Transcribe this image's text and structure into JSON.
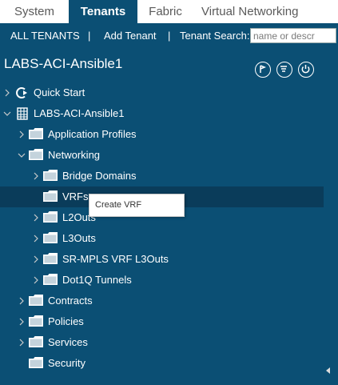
{
  "tabs": [
    {
      "label": "System"
    },
    {
      "label": "Tenants"
    },
    {
      "label": "Fabric"
    },
    {
      "label": "Virtual Networking"
    }
  ],
  "subnav": {
    "all_tenants": "ALL TENANTS",
    "separator": "|",
    "add_tenant": "Add Tenant",
    "search_label": "Tenant Search:",
    "search_placeholder": "name or descr"
  },
  "title": "LABS-ACI-Ansible1",
  "tree": [
    {
      "label": "Quick Start"
    },
    {
      "label": "LABS-ACI-Ansible1"
    },
    {
      "label": "Application Profiles"
    },
    {
      "label": "Networking"
    },
    {
      "label": "Bridge Domains"
    },
    {
      "label": "VRFs"
    },
    {
      "label": "L2Outs"
    },
    {
      "label": "L3Outs"
    },
    {
      "label": "SR-MPLS VRF L3Outs"
    },
    {
      "label": "Dot1Q Tunnels"
    },
    {
      "label": "Contracts"
    },
    {
      "label": "Policies"
    },
    {
      "label": "Services"
    },
    {
      "label": "Security"
    }
  ],
  "context_menu": {
    "create_vrf": "Create VRF"
  },
  "colors": {
    "background": "#0b4f74",
    "selected_row": "#0a3c5a",
    "tab_bar": "#ffffff"
  }
}
